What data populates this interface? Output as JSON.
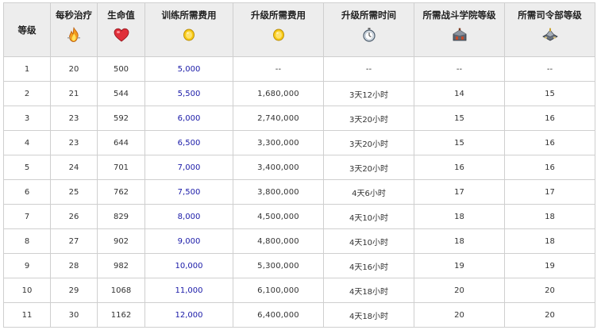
{
  "table": {
    "headers": {
      "level": "等级",
      "heal_per_sec": "每秒治疗",
      "hp": "生命值",
      "train_cost": "训练所需费用",
      "upgrade_cost": "升级所需费用",
      "upgrade_time": "升级所需时间",
      "academy_level": "所需战斗学院等级",
      "hq_level": "所需司令部等级"
    },
    "icons": {
      "heal_per_sec": "heal-flame-icon",
      "hp": "heart-icon",
      "train_cost": "gold-coin-icon",
      "upgrade_cost": "gold-coin-icon",
      "upgrade_time": "stopwatch-icon",
      "academy_level": "academy-building-icon",
      "hq_level": "headquarters-building-icon"
    },
    "colors": {
      "header_bg": "#ededed",
      "border": "#cfcfcf",
      "link_text": "#1a1aa8",
      "text": "#333333"
    },
    "rows": [
      {
        "level": "1",
        "heal": "20",
        "hp": "500",
        "train_cost": "5,000",
        "upgrade_cost": "--",
        "upgrade_time": "--",
        "academy": "--",
        "hq": "--"
      },
      {
        "level": "2",
        "heal": "21",
        "hp": "544",
        "train_cost": "5,500",
        "upgrade_cost": "1,680,000",
        "upgrade_time": "3天12小时",
        "academy": "14",
        "hq": "15"
      },
      {
        "level": "3",
        "heal": "23",
        "hp": "592",
        "train_cost": "6,000",
        "upgrade_cost": "2,740,000",
        "upgrade_time": "3天20小时",
        "academy": "15",
        "hq": "16"
      },
      {
        "level": "4",
        "heal": "23",
        "hp": "644",
        "train_cost": "6,500",
        "upgrade_cost": "3,300,000",
        "upgrade_time": "3天20小时",
        "academy": "15",
        "hq": "16"
      },
      {
        "level": "5",
        "heal": "24",
        "hp": "701",
        "train_cost": "7,000",
        "upgrade_cost": "3,400,000",
        "upgrade_time": "3天20小时",
        "academy": "16",
        "hq": "16"
      },
      {
        "level": "6",
        "heal": "25",
        "hp": "762",
        "train_cost": "7,500",
        "upgrade_cost": "3,800,000",
        "upgrade_time": "4天6小时",
        "academy": "17",
        "hq": "17"
      },
      {
        "level": "7",
        "heal": "26",
        "hp": "829",
        "train_cost": "8,000",
        "upgrade_cost": "4,500,000",
        "upgrade_time": "4天10小时",
        "academy": "18",
        "hq": "18"
      },
      {
        "level": "8",
        "heal": "27",
        "hp": "902",
        "train_cost": "9,000",
        "upgrade_cost": "4,800,000",
        "upgrade_time": "4天10小时",
        "academy": "18",
        "hq": "18"
      },
      {
        "level": "9",
        "heal": "28",
        "hp": "982",
        "train_cost": "10,000",
        "upgrade_cost": "5,300,000",
        "upgrade_time": "4天16小时",
        "academy": "19",
        "hq": "19"
      },
      {
        "level": "10",
        "heal": "29",
        "hp": "1068",
        "train_cost": "11,000",
        "upgrade_cost": "6,100,000",
        "upgrade_time": "4天18小时",
        "academy": "20",
        "hq": "20"
      },
      {
        "level": "11",
        "heal": "30",
        "hp": "1162",
        "train_cost": "12,000",
        "upgrade_cost": "6,400,000",
        "upgrade_time": "4天18小时",
        "academy": "20",
        "hq": "20"
      }
    ]
  }
}
